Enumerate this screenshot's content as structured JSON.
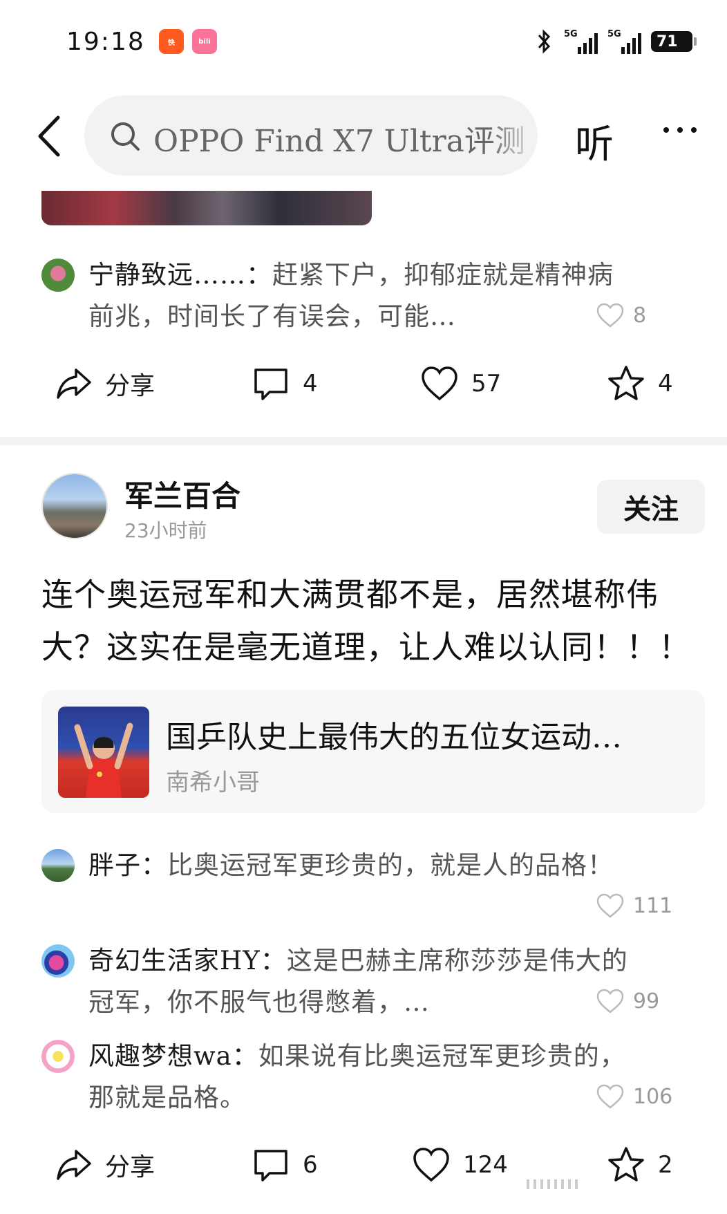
{
  "status_bar": {
    "time": "19:18",
    "battery": "71",
    "signal_1_label": "5G",
    "signal_2_label": "5G",
    "app_icon_1_text": "快",
    "app_icon_2_text": "bili"
  },
  "header": {
    "search_text": "OPPO Find X7 Ultra评测",
    "listen_label": "听"
  },
  "post1": {
    "comment": {
      "author": "宁静致远……",
      "text": "赶紧下户，抑郁症就是精神病前兆，时间长了有误会，可能…",
      "likes": "8"
    },
    "actions": {
      "share": "分享",
      "comments": "4",
      "likes": "57",
      "favorites": "4"
    }
  },
  "post2": {
    "author": "军兰百合",
    "time": "23小时前",
    "follow_label": "关注",
    "body": "连个奥运冠军和大满贯都不是，居然堪称伟大？这实在是毫无道理，让人难以认同！！！",
    "link_card": {
      "title": "国乒队史上最伟大的五位女运动…",
      "source": "南希小哥"
    },
    "comments": [
      {
        "author": "胖子",
        "text": "比奥运冠军更珍贵的，就是人的品格！",
        "likes": "111"
      },
      {
        "author": "奇幻生活家HY",
        "text": "这是巴赫主席称莎莎是伟大的冠军，你不服气也得憋着，…",
        "likes": "99"
      },
      {
        "author": "风趣梦想wa",
        "text": "如果说有比奥运冠军更珍贵的，那就是品格。",
        "likes": "106"
      }
    ],
    "actions": {
      "share": "分享",
      "comments": "6",
      "likes": "124",
      "favorites": "2"
    }
  },
  "colors": {
    "text": "#1a1a1a",
    "secondary": "#999999",
    "search_bg": "#f2f2f4",
    "divider": "#f2f2f2"
  }
}
